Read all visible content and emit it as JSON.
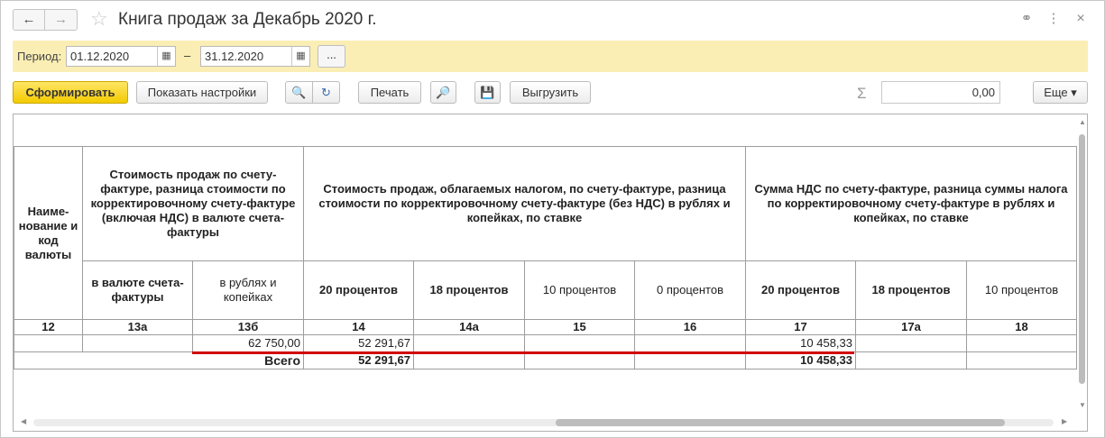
{
  "window": {
    "title": "Книга продаж за Декабрь 2020 г.",
    "back_icon": "←",
    "forward_icon": "→",
    "star_icon": "☆",
    "link_icon": "⚭",
    "more_icon": "⋮",
    "close_icon": "×"
  },
  "period": {
    "label": "Период:",
    "date_from": "01.12.2020",
    "date_to": "31.12.2020",
    "dash": "–",
    "dots_label": "...",
    "calendar_icon": "▦"
  },
  "toolbar": {
    "generate_label": "Сформировать",
    "settings_label": "Показать настройки",
    "search_icon": "🔍",
    "search_refresh_icon": "↻",
    "print_label": "Печать",
    "preview_icon": "🔎",
    "save_icon": "💾",
    "export_label": "Выгрузить",
    "sigma_icon": "Σ",
    "sum_value": "0,00",
    "more_label": "Еще ▾"
  },
  "report": {
    "headers": {
      "col12": "Наиме-нование и код валюты",
      "col13_group": "Стоимость продаж по счету-фактуре, разница стоимости по корректировочному счету-фактуре (включая НДС) в валюте счета-фактуры",
      "col13a": "в валюте счета-фактуры",
      "col13b": "в рублях и копейках",
      "col14_group": "Стоимость продаж, облагаемых налогом, по счету-фактуре, разница стоимости по корректировочному счету-фактуре (без НДС) в рублях и копейках, по ставке",
      "col14": "20 процентов",
      "col14a": "18 процентов",
      "col15": "10 процентов",
      "col16": "0 процентов",
      "col17_group": "Сумма НДС по счету-фактуре, разница суммы налога по корректировочному счету-фактуре в рублях и копейках, по ставке",
      "col17": "20 процентов",
      "col17a": "18 процентов",
      "col18": "10 процентов"
    },
    "col_numbers": [
      "12",
      "13а",
      "13б",
      "14",
      "14а",
      "15",
      "16",
      "17",
      "17а",
      "18"
    ],
    "row1": {
      "c13b": "62 750,00",
      "c14": "52 291,67",
      "c17": "10 458,33"
    },
    "total": {
      "label": "Всего",
      "c14": "52 291,67",
      "c17": "10 458,33"
    }
  }
}
